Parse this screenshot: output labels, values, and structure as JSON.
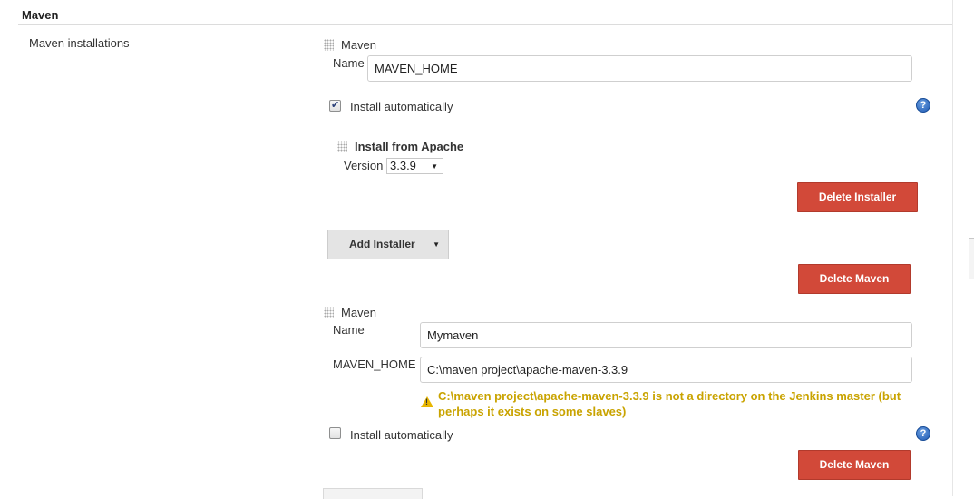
{
  "section": {
    "title": "Maven"
  },
  "maven_installations": {
    "label": "Maven installations",
    "items": [
      {
        "header": "Maven",
        "name_label": "Name",
        "name_value": "MAVEN_HOME",
        "install_automatically": {
          "label": "Install automatically",
          "checked": true
        },
        "installer": {
          "header": "Install from Apache",
          "version_label": "Version",
          "version_value": "3.3.9",
          "delete_label": "Delete Installer"
        },
        "add_installer_label": "Add Installer",
        "delete_label": "Delete Maven"
      },
      {
        "header": "Maven",
        "name_label": "Name",
        "name_value": "Mymaven",
        "home_label": "MAVEN_HOME",
        "home_value": "C:\\maven project\\apache-maven-3.3.9",
        "warning": "C:\\maven project\\apache-maven-3.3.9 is not a directory on the Jenkins master (but perhaps it exists on some slaves)",
        "install_automatically": {
          "label": "Install automatically",
          "checked": false
        },
        "delete_label": "Delete Maven"
      }
    ]
  },
  "icons": {
    "help": "help-icon",
    "drag": "drag-handle-icon",
    "warning": "warning-icon",
    "checkmark": "checkmark-icon",
    "dropdown": "chevron-down-icon"
  },
  "colors": {
    "delete_button": "#d24939",
    "warning_text": "#c9a300",
    "help_icon": "#2a66c2"
  }
}
